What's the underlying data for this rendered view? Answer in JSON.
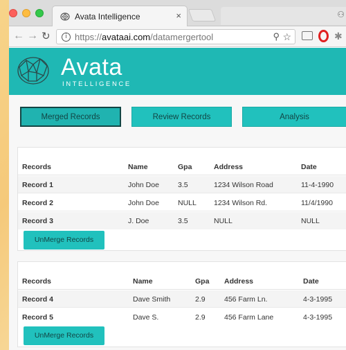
{
  "browser": {
    "tab_title": "Avata Intelligence",
    "tab_close": "×",
    "url_scheme": "https://",
    "url_host": "avataai.com",
    "url_path": "/datamergertool"
  },
  "site": {
    "logo_text": "Avata",
    "logo_sub": "INTELLIGENCE"
  },
  "nav": {
    "merged": "Merged Records",
    "review": "Review Records",
    "analysis": "Analysis"
  },
  "group1": {
    "headers": [
      "Records",
      "Name",
      "Gpa",
      "Address",
      "Date"
    ],
    "rows": [
      [
        "Record 1",
        "John Doe",
        "3.5",
        "1234 Wilson Road",
        "11-4-1990"
      ],
      [
        "Record 2",
        "John Doe",
        "NULL",
        "1234 Wilson Rd.",
        "11/4/1990"
      ],
      [
        "Record 3",
        "J. Doe",
        "3.5",
        "NULL",
        "NULL"
      ]
    ],
    "button": "UnMerge Records"
  },
  "group2": {
    "headers": [
      "Records",
      "Name",
      "Gpa",
      "Address",
      "Date"
    ],
    "rows": [
      [
        "Record 4",
        "Dave Smith",
        "2.9",
        "456 Farm Ln.",
        "4-3-1995"
      ],
      [
        "Record 5",
        "Dave S.",
        "2.9",
        "456 Farm Lane",
        "4-3-1995"
      ]
    ],
    "button": "UnMerge Records"
  },
  "colors": {
    "brand_teal": "#1fb8b4",
    "button_teal": "#21c1bd",
    "button_text": "#124544"
  }
}
